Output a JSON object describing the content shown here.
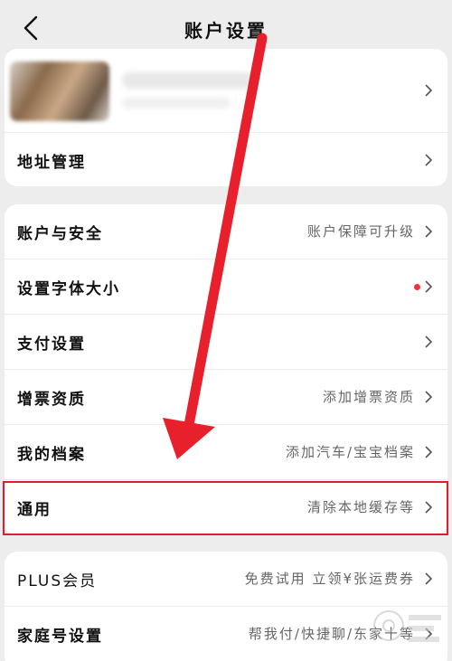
{
  "header": {
    "title": "账户设置"
  },
  "card1": {
    "address": {
      "label": "地址管理"
    }
  },
  "card2": {
    "items": [
      {
        "label": "账户与安全",
        "value": "账户保障可升级"
      },
      {
        "label": "设置字体大小",
        "value": ""
      },
      {
        "label": "支付设置",
        "value": ""
      },
      {
        "label": "增票资质",
        "value": "添加增票资质"
      },
      {
        "label": "我的档案",
        "value": "添加汽车/宝宝档案"
      },
      {
        "label": "通用",
        "value": "清除本地缓存等"
      }
    ]
  },
  "card3": {
    "items": [
      {
        "label": "PLUS会员",
        "value": "免费试用 立领¥张运费券"
      },
      {
        "label": "家庭号设置",
        "value": "帮我付/快捷聊/东家十等"
      }
    ]
  },
  "colors": {
    "highlight": "#e01e2b",
    "arrow": "#e8202b",
    "dot": "#f2323c"
  }
}
